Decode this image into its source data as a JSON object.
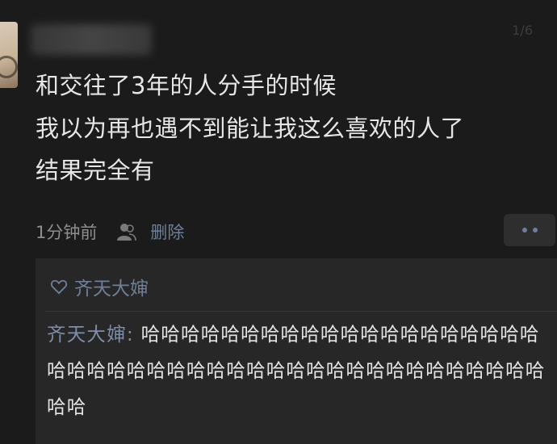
{
  "post": {
    "pager": "1/6",
    "lines": [
      "和交往了3年的人分手的时候",
      "我以为再也遇不到能让我这么喜欢的人了",
      "结果完全有"
    ],
    "time": "1分钟前",
    "delete_label": "删除"
  },
  "likes": {
    "name": "齐天大婶"
  },
  "comment": {
    "author": "齐天大婶",
    "separator": ": ",
    "text": "哈哈哈哈哈哈哈哈哈哈哈哈哈哈哈哈哈哈哈哈哈哈哈哈哈哈哈哈哈哈哈哈哈哈哈哈哈哈哈哈哈哈哈哈哈哈哈"
  },
  "colors": {
    "background": "#1b1b1b",
    "link_blue": "#6f7f99",
    "text": "#e6e6e6",
    "muted": "#8e8e8e"
  },
  "icons": {
    "visibility": "people-icon",
    "like": "heart-outline-icon",
    "more": "more-dots-icon"
  }
}
